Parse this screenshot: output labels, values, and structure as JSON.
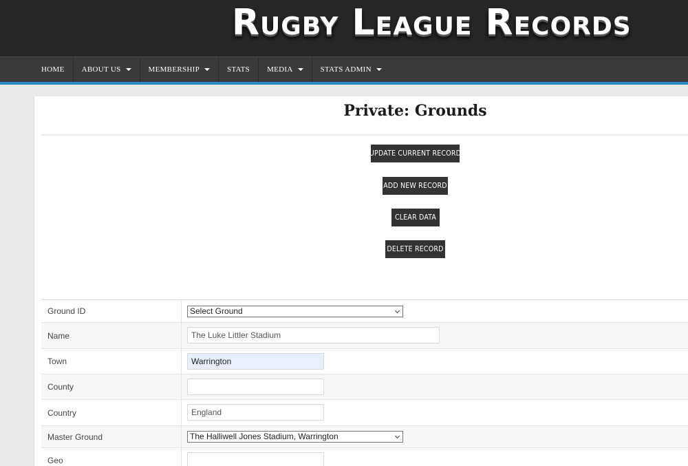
{
  "site": {
    "title": "Rugby League Records"
  },
  "nav": {
    "items": [
      {
        "label": "HOME",
        "dropdown": false
      },
      {
        "label": "ABOUT US",
        "dropdown": true
      },
      {
        "label": "MEMBERSHIP",
        "dropdown": true
      },
      {
        "label": "STATS",
        "dropdown": false
      },
      {
        "label": "MEDIA",
        "dropdown": true
      },
      {
        "label": "STATS ADMIN",
        "dropdown": true
      }
    ]
  },
  "page": {
    "title": "Private: Grounds"
  },
  "actions": {
    "update": "UPDATE CURRENT RECORD",
    "add": "ADD NEW RECORD",
    "clear": "CLEAR DATA",
    "delete": "DELETE RECORD"
  },
  "form": {
    "ground_id": {
      "label": "Ground ID",
      "value": "Select Ground"
    },
    "name": {
      "label": "Name",
      "value": "The Luke Littler Stadium"
    },
    "town": {
      "label": "Town",
      "value": "Warrington"
    },
    "county": {
      "label": "County",
      "value": ""
    },
    "country": {
      "label": "Country",
      "value": "England"
    },
    "master_ground": {
      "label": "Master Ground",
      "value": "The Halliwell Jones Stadium, Warrington"
    },
    "geo": {
      "label": "Geo",
      "value": ""
    }
  },
  "colors": {
    "header_bg": "#262626",
    "nav_bg": "#3a3a3a",
    "nav_accent": "#2b89c9",
    "button_bg": "#333333"
  }
}
